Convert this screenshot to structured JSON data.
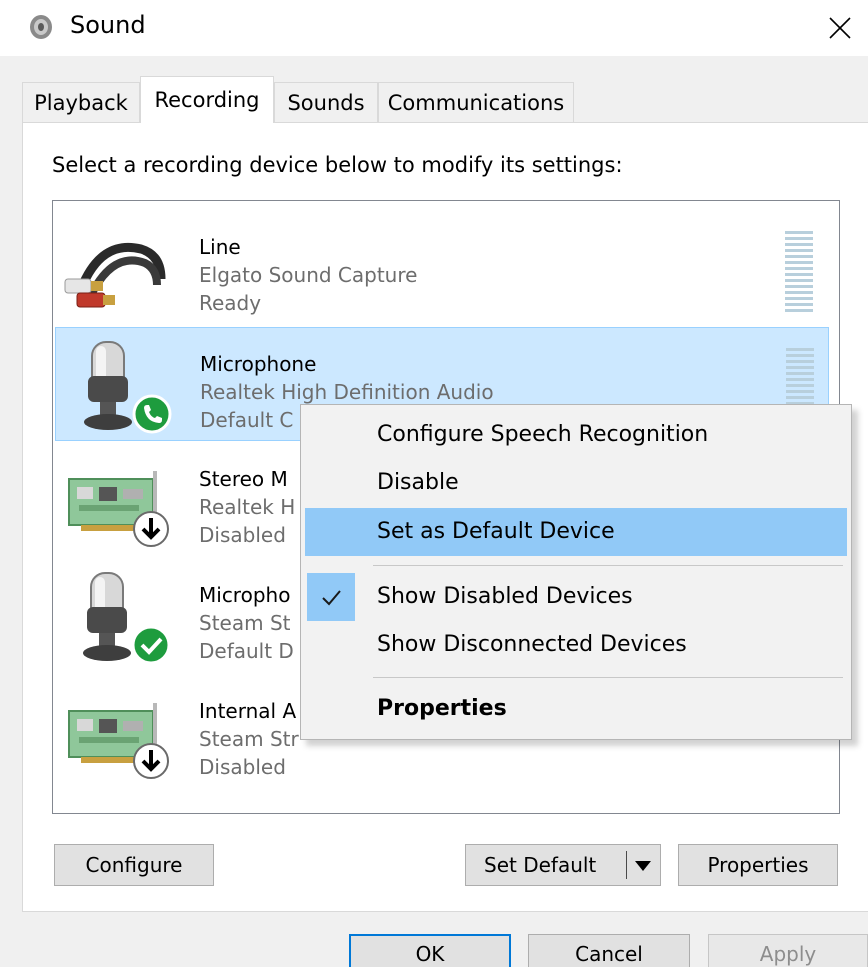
{
  "window": {
    "title": "Sound"
  },
  "tabs": [
    {
      "label": "Playback"
    },
    {
      "label": "Recording"
    },
    {
      "label": "Sounds"
    },
    {
      "label": "Communications"
    }
  ],
  "instruction": "Select a recording device below to modify its settings:",
  "devices": [
    {
      "name": "Line",
      "driver": "Elgato Sound Capture",
      "status": "Ready",
      "icon": "line-in-cable-icon"
    },
    {
      "name": "Microphone",
      "driver": "Realtek High Definition Audio",
      "status": "Default C",
      "icon": "microphone-icon",
      "badge": "default-communications-phone-badge"
    },
    {
      "name": "Stereo M",
      "driver": "Realtek H",
      "status": "Disabled",
      "icon": "sound-card-icon",
      "badge": "disabled-arrow-badge"
    },
    {
      "name": "Micropho",
      "driver": "Steam St",
      "status": "Default D",
      "icon": "microphone-icon",
      "badge": "default-device-check-badge"
    },
    {
      "name": "Internal A",
      "driver": "Steam Str",
      "status": "Disabled",
      "icon": "sound-card-icon",
      "badge": "disabled-arrow-badge"
    }
  ],
  "buttons": {
    "configure": "Configure",
    "set_default": "Set Default",
    "properties": "Properties",
    "ok": "OK",
    "cancel": "Cancel",
    "apply": "Apply"
  },
  "context_menu": {
    "items": [
      {
        "label": "Configure Speech Recognition"
      },
      {
        "label": "Disable"
      },
      {
        "label": "Set as Default Device",
        "highlighted": true
      },
      {
        "label": "Show Disabled Devices",
        "checked": true
      },
      {
        "label": "Show Disconnected Devices"
      },
      {
        "label": "Properties",
        "bold": true
      }
    ]
  },
  "colors": {
    "selection": "#cce8ff",
    "menu_highlight": "#91c9f7",
    "default_badge": "#1e9c3e",
    "primary_border": "#0078d7"
  }
}
